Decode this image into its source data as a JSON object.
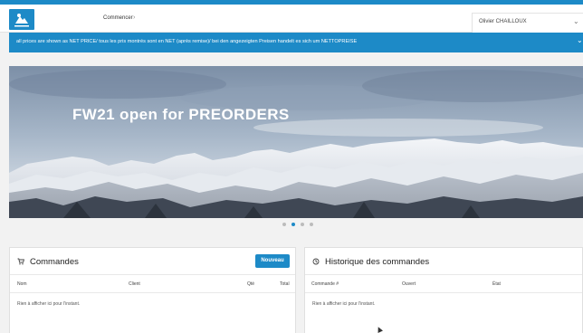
{
  "header": {
    "breadcrumb": "Commencer",
    "breadcrumb_sep": "›",
    "user_name": "Olivier CHAILLOUX",
    "user_chevron": "⌄"
  },
  "banner": {
    "text": "all prices are shown as NET PRICE/ tous les pris montrés sont en NET (après remise)/ bei den angezeigten Preisen handelt es sich um NETTOPREISE",
    "chevron": "⌄"
  },
  "hero": {
    "title": "FW21 open for PREORDERS",
    "slides": 4,
    "active_slide": 1
  },
  "orders": {
    "icon": "cart-icon",
    "title": "Commandes",
    "new_button": "Nouveau",
    "columns": [
      "Nom",
      "Client",
      "Qté",
      "Total"
    ],
    "empty": "Rien à afficher ici pour l'instant."
  },
  "history": {
    "icon": "history-icon",
    "title": "Historique des commandes",
    "columns": [
      "Commande #",
      "Ouvert",
      "État"
    ],
    "empty": "Rien à afficher ici pour l'instant."
  },
  "colors": {
    "accent": "#1d8ac7",
    "background": "#f2f2f2"
  }
}
